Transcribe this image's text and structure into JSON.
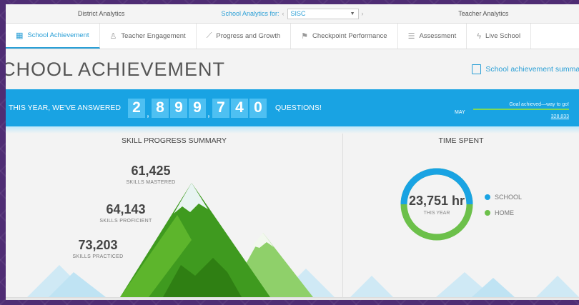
{
  "topbar": {
    "district": "District Analytics",
    "school_label": "School Analytics for:",
    "school_value": "SISC",
    "teacher": "Teacher Analytics"
  },
  "tabs": [
    {
      "label": "School Achievement",
      "icon": "chart-icon"
    },
    {
      "label": "Teacher Engagement",
      "icon": "people-icon"
    },
    {
      "label": "Progress and Growth",
      "icon": "growth-icon"
    },
    {
      "label": "Checkpoint Performance",
      "icon": "checkpoint-icon"
    },
    {
      "label": "Assessment",
      "icon": "list-icon"
    },
    {
      "label": "Live School",
      "icon": "bolt-icon"
    }
  ],
  "page": {
    "title": "CHOOL ACHIEVEMENT",
    "summary_link": "School achievement summary"
  },
  "banner": {
    "lead": "THIS YEAR, WE'VE ANSWERED",
    "digits": [
      "2",
      "8",
      "9",
      "9",
      "7",
      "4",
      "0"
    ],
    "tail": "QUESTIONS!",
    "goal_month": "MAY",
    "goal_msg": "Goal achieved—way to go!",
    "goal_number": "328,833",
    "colors": {
      "banner": "#19a3e3",
      "digit_bg": "#4ec0f2",
      "goal_line": "#7ed957"
    }
  },
  "skills": {
    "title": "SKILL PROGRESS SUMMARY",
    "mastered_value": "61,425",
    "mastered_label": "SKILLS MASTERED",
    "proficient_value": "64,143",
    "proficient_label": "SKILLS PROFICIENT",
    "practiced_value": "73,203",
    "practiced_label": "SKILLS PRACTICED"
  },
  "time": {
    "title": "TIME SPENT",
    "value": "23,751 hr",
    "sub": "THIS YEAR",
    "legend": [
      {
        "label": "SCHOOL",
        "color": "#19a3e3"
      },
      {
        "label": "HOME",
        "color": "#6cc04a"
      }
    ]
  }
}
